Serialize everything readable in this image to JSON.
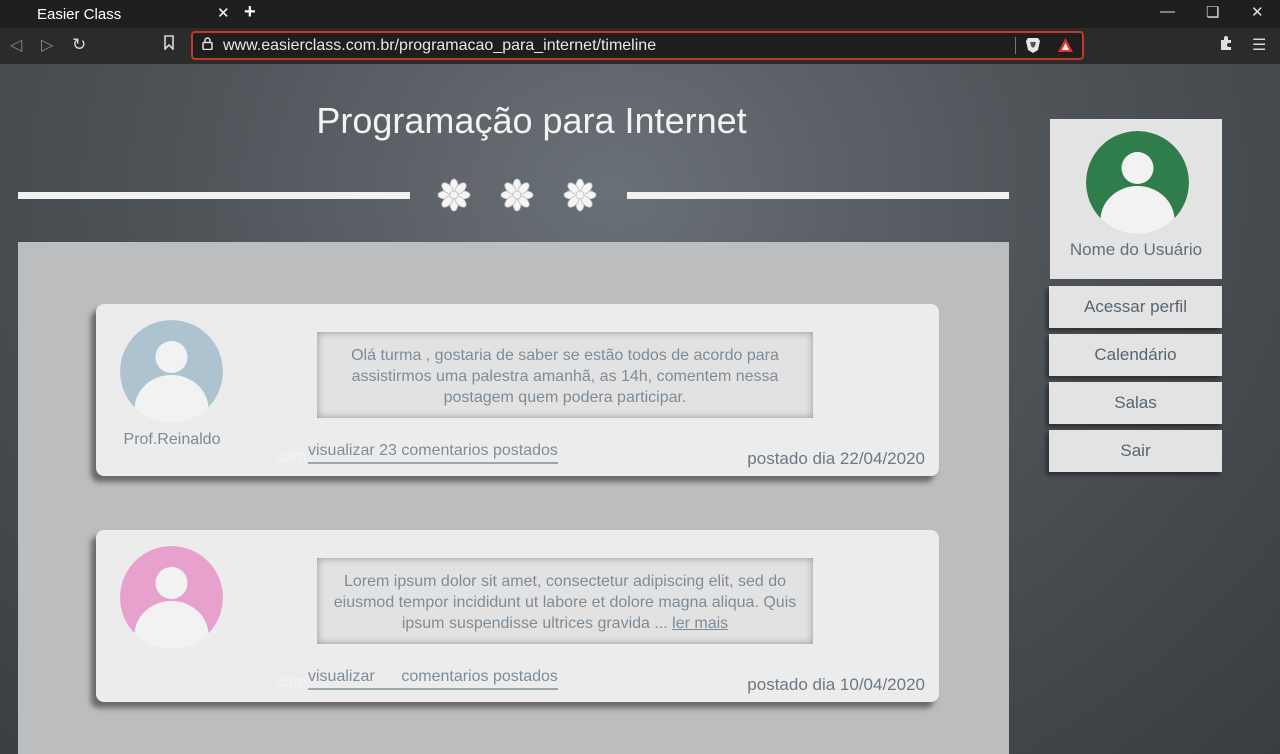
{
  "browser": {
    "tab_title": "Easier Class",
    "tab_close": "✕",
    "new_tab": "+",
    "url": "www.easierclass.com.br/programacao_para_internet/timeline"
  },
  "page": {
    "title": "Programação para Internet"
  },
  "posts": [
    {
      "author": "Prof.Reinaldo",
      "text": "Olá turma , gostaria de saber se estão todos de acordo para assistirmos uma palestra amanhã, as 14h, comentem nessa postagem quem podera participar.",
      "read_more": "",
      "comments_link": "visualizar 23 comentarios postados",
      "ghost_text": "com",
      "date": "postado dia 22/04/2020",
      "avatar_color": "#aec3d0"
    },
    {
      "author": "",
      "text": "Lorem ipsum dolor sit amet, consectetur adipiscing elit, sed do eiusmod tempor incididunt ut labore et dolore magna aliqua. Quis ipsum suspendisse ultrices gravida ...",
      "read_more": "ler mais",
      "comments_link": "visualizar      comentarios postados",
      "ghost_text": "com",
      "date": "postado dia 10/04/2020",
      "avatar_color": "#e8a0cd"
    }
  ],
  "sidebar": {
    "user_name": "Nome do Usuário",
    "user_avatar_color": "#2f7d4a",
    "buttons": [
      "Acessar perfil",
      "Calendário",
      "Salas",
      "Sair"
    ]
  },
  "icons": [
    "back-icon",
    "forward-icon",
    "reload-icon",
    "bookmark-icon",
    "lock-icon",
    "brave-shield-icon",
    "bat-rewards-icon",
    "extensions-icon",
    "menu-icon",
    "flower-icon"
  ]
}
